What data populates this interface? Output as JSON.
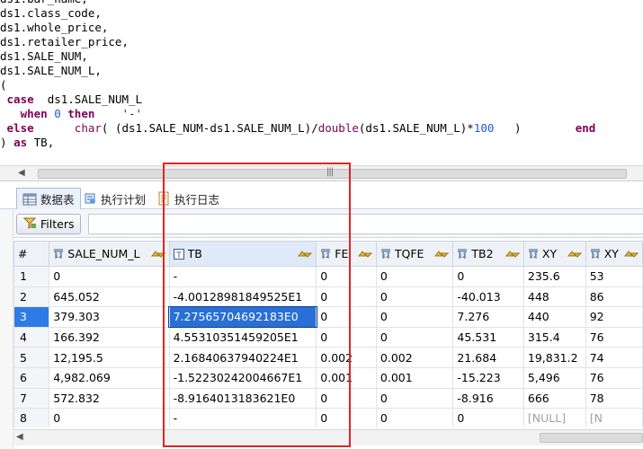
{
  "editor": {
    "lines": [
      [
        {
          "t": "ds1.bar_name,"
        }
      ],
      [
        {
          "t": "ds1.class_code,"
        }
      ],
      [
        {
          "t": "ds1.whole_price,"
        }
      ],
      [
        {
          "t": "ds1.retailer_price,"
        }
      ],
      [
        {
          "t": "ds1.SALE_NUM,"
        }
      ],
      [
        {
          "t": "ds1.SALE_NUM_L,"
        }
      ],
      [
        {
          "t": "("
        }
      ],
      [
        {
          "t": " "
        },
        {
          "t": "case",
          "c": "kw"
        },
        {
          "t": "  ds1.SALE_NUM_L"
        }
      ],
      [
        {
          "t": "   "
        },
        {
          "t": "when",
          "c": "kw"
        },
        {
          "t": " "
        },
        {
          "t": "0",
          "c": "num"
        },
        {
          "t": " "
        },
        {
          "t": "then",
          "c": "kw"
        },
        {
          "t": "    "
        },
        {
          "t": "'-'",
          "c": "str"
        }
      ],
      [
        {
          "t": " "
        },
        {
          "t": "else",
          "c": "kw"
        },
        {
          "t": "      "
        },
        {
          "t": "char",
          "c": "fn"
        },
        {
          "t": "( (ds1.SALE_NUM-ds1.SALE_NUM_L)/"
        },
        {
          "t": "double",
          "c": "fn"
        },
        {
          "t": "(ds1.SALE_NUM_L)*"
        },
        {
          "t": "100",
          "c": "num"
        },
        {
          "t": "   )        "
        },
        {
          "t": "end",
          "c": "kw"
        }
      ],
      [
        {
          "t": ") "
        },
        {
          "t": "as",
          "c": "kw"
        },
        {
          "t": " TB,"
        }
      ]
    ]
  },
  "scroll": {
    "left_arrow": "◀",
    "grip": "|||"
  },
  "tabs": [
    {
      "label": "数据表",
      "icon": "table-icon"
    },
    {
      "label": "执行计划",
      "icon": "plan-icon"
    },
    {
      "label": "执行日志",
      "icon": "log-icon"
    }
  ],
  "filters": {
    "label": "Filters",
    "icon": "filter-icon",
    "value": ""
  },
  "grid": {
    "rownum_header": "#",
    "columns": [
      {
        "name": "SALE_NUM_L",
        "type_icon": "numeric-column-icon"
      },
      {
        "name": "TB",
        "type_icon": "text-column-icon"
      },
      {
        "name": "FE",
        "type_icon": "numeric-column-icon"
      },
      {
        "name": "TQFE",
        "type_icon": "numeric-column-icon"
      },
      {
        "name": "TB2",
        "type_icon": "numeric-column-icon"
      },
      {
        "name": "XY",
        "type_icon": "numeric-column-icon"
      },
      {
        "name": "XY",
        "type_icon": "numeric-column-icon"
      }
    ],
    "rows": [
      [
        "1",
        "0",
        "-",
        "0",
        "0",
        "0",
        "235.6",
        "53"
      ],
      [
        "2",
        "645.052",
        "-4.00128981849525E1",
        "0",
        "0",
        "-40.013",
        "448",
        "86"
      ],
      [
        "3",
        "379.303",
        "7.27565704692183E0",
        "0",
        "0",
        "7.276",
        "440",
        "92"
      ],
      [
        "4",
        "166.392",
        "4.55310351459205E1",
        "0",
        "0",
        "45.531",
        "315.4",
        "76"
      ],
      [
        "5",
        "12,195.5",
        "2.16840637940224E1",
        "0.002",
        "0.002",
        "21.684",
        "19,831.2",
        "74"
      ],
      [
        "6",
        "4,982.069",
        "-1.52230242004667E1",
        "0.001",
        "0.001",
        "-15.223",
        "5,496",
        "76"
      ],
      [
        "7",
        "572.832",
        "-8.9164013183621E0",
        "0",
        "0",
        "-8.916",
        "666",
        "78"
      ],
      [
        "8",
        "0",
        "-",
        "0",
        "0",
        "0",
        "[NULL]",
        "[N"
      ]
    ],
    "selected": {
      "row": 2,
      "col": 2
    },
    "null_text": "[NULL]"
  },
  "colors": {
    "accent": "#2a6fd6",
    "annotation": "#e02424",
    "keyword": "#7f0055",
    "string": "#2a00ff"
  }
}
